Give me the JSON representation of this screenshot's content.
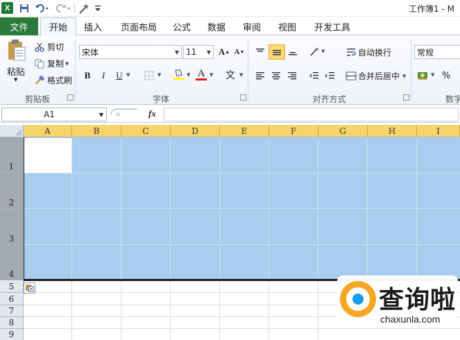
{
  "window": {
    "title": "工作簿1 - M"
  },
  "quick_access": {
    "logo": "X"
  },
  "tabs": [
    "文件",
    "开始",
    "插入",
    "页面布局",
    "公式",
    "数据",
    "审阅",
    "视图",
    "开发工具"
  ],
  "ribbon": {
    "clipboard": {
      "paste": "粘贴",
      "cut": "剪切",
      "copy": "复制",
      "format_painter": "格式刷",
      "group": "剪贴板"
    },
    "font": {
      "name": "宋体",
      "size": "11",
      "bold": "B",
      "italic": "I",
      "underline": "U",
      "font_color": "A",
      "wen": "文",
      "group": "字体"
    },
    "alignment": {
      "wrap_text": "自动换行",
      "merge_center": "合并后居中",
      "group": "对齐方式"
    },
    "number": {
      "format": "常规",
      "percent": "%",
      "group": "数字"
    }
  },
  "formula_bar": {
    "name_box": "A1",
    "fx": "fx",
    "value": ""
  },
  "grid": {
    "columns": [
      "A",
      "B",
      "C",
      "D",
      "E",
      "F",
      "G",
      "H",
      "I"
    ],
    "rows": [
      "1",
      "2",
      "3",
      "4",
      "5",
      "6",
      "7",
      "8",
      "9"
    ],
    "selected_range": "A1:I4"
  },
  "watermark": {
    "brand": "查询啦",
    "domain": "chaxunla.com"
  },
  "colors": {
    "file_tab": "#2b7a3b",
    "selection": "#a9cdee",
    "col_header_selected": "#f7d46b",
    "row_header_selected": "#a2a9b1"
  }
}
